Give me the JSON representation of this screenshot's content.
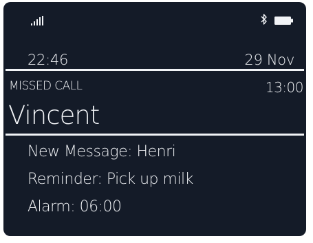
{
  "status_bar": {
    "signal_icon": "signal-bars-icon",
    "bluetooth_icon": "bluetooth-icon",
    "battery_icon": "battery-icon"
  },
  "clock": {
    "time": "22:46",
    "date": "29 Nov"
  },
  "missed_call": {
    "label": "MISSED CALL",
    "time": "13:00",
    "caller": "Vincent"
  },
  "notifications": [
    {
      "text": "New Message: Henri"
    },
    {
      "text": "Reminder: Pick up milk"
    },
    {
      "text": "Alarm: 06:00"
    }
  ],
  "colors": {
    "background": "#141b28",
    "foreground": "#f1f3f6"
  }
}
